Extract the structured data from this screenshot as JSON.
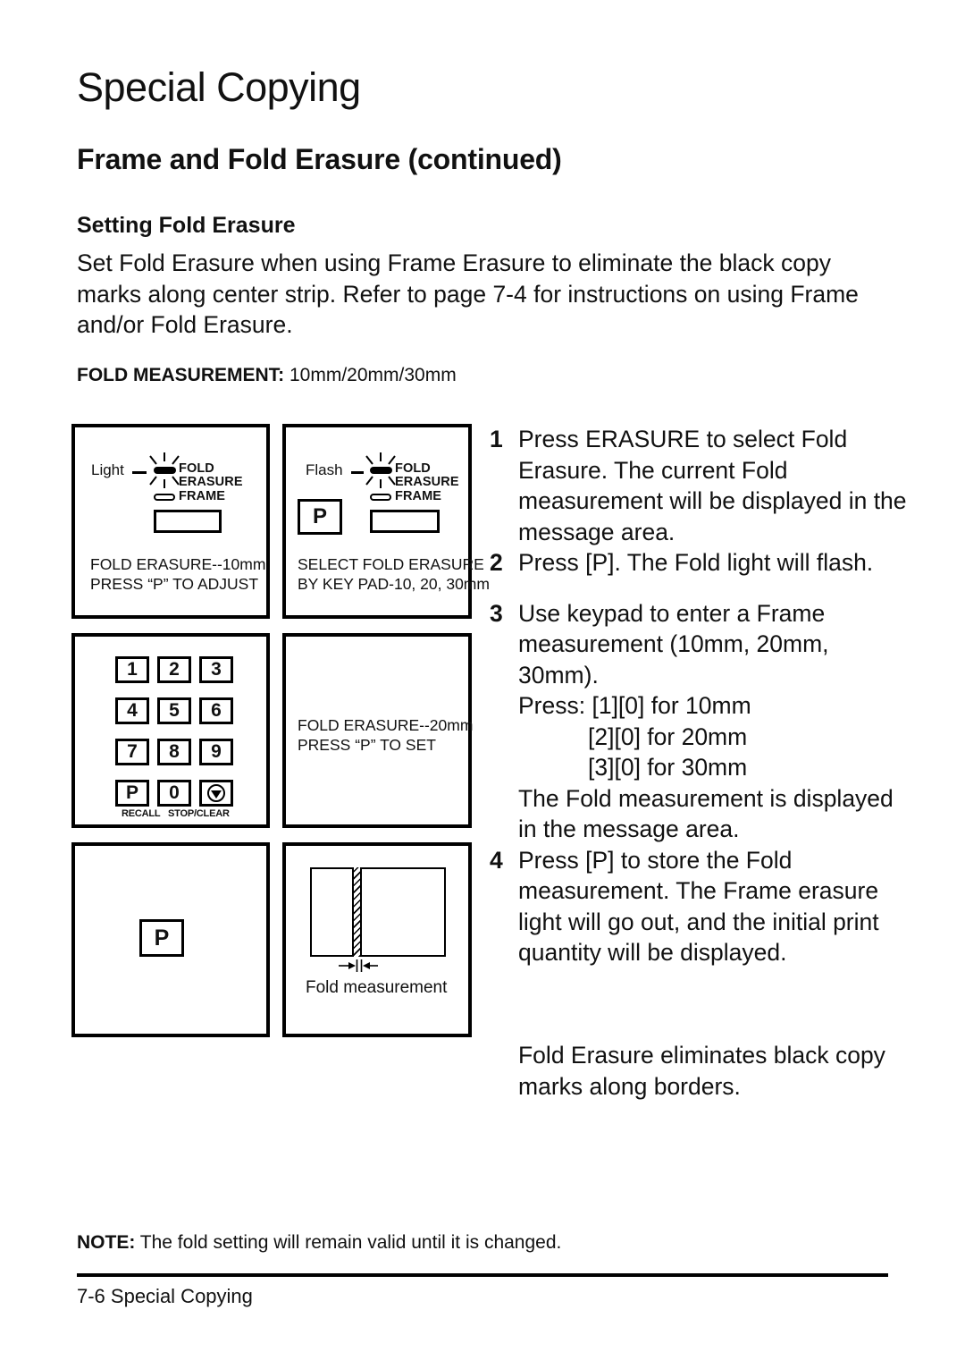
{
  "document": {
    "page_title": "Special Copying",
    "section_title": "Frame and Fold Erasure (continued)",
    "sub_title": "Setting Fold Erasure",
    "intro_paragraph": "Set Fold Erasure when using Frame Erasure to eliminate the black copy marks along center strip. Refer to page 7-4 for instructions on using Frame and/or Fold Erasure.",
    "fold_measurement_label": "FOLD MEASUREMENT:",
    "fold_measurement_values": " 10mm/20mm/30mm",
    "note_label": "NOTE:",
    "note_text": " The fold setting will remain valid until it is changed.",
    "folio": "7-6 Special Copying"
  },
  "figures": {
    "panel1": {
      "state_label": "Light",
      "led_lines": [
        "FOLD",
        "ERASURE"
      ],
      "frame_line": "FRAME",
      "caption_line1": "FOLD ERASURE--10mm",
      "caption_line2": "PRESS “P” TO ADJUST"
    },
    "panel2": {
      "state_label": "Flash",
      "led_lines": [
        "FOLD",
        "ERASURE"
      ],
      "frame_line": "FRAME",
      "p_button": "P",
      "caption_line1": "SELECT FOLD ERASURE",
      "caption_line2": "BY KEY PAD-10, 20, 30mm"
    },
    "panel3_keypad": {
      "keys": [
        "1",
        "2",
        "3",
        "4",
        "5",
        "6",
        "7",
        "8",
        "9",
        "P",
        "0",
        "stop-clear-icon"
      ],
      "sub_label_recall": "RECALL",
      "sub_label_stopclear": "STOP/CLEAR"
    },
    "panel4": {
      "caption_line1": "FOLD ERASURE--20mm",
      "caption_line2": "PRESS “P” TO SET"
    },
    "panel5": {
      "p_button": "P"
    },
    "panel6": {
      "caption": "Fold measurement"
    }
  },
  "steps": [
    {
      "num": "1",
      "text": "Press ERASURE to select Fold Erasure. The current Fold measurement will be displayed in the message area."
    },
    {
      "num": "2",
      "text": "Press [P]. The Fold light will flash."
    },
    {
      "num": "3",
      "text": "Use keypad to enter a Frame measurement (10mm, 20mm, 30mm).",
      "press_lead": "Press: [1][0] for 10mm",
      "press_line2": "[2][0] for 20mm",
      "press_line3": "[3][0] for 30mm",
      "tail": "The Fold measurement is displayed in the message area."
    },
    {
      "num": "4",
      "text": "Press [P] to store the Fold measurement. The Frame erasure light will go out, and the initial print quantity will be displayed."
    }
  ],
  "closing_paragraph": "Fold Erasure eliminates black copy marks along borders."
}
